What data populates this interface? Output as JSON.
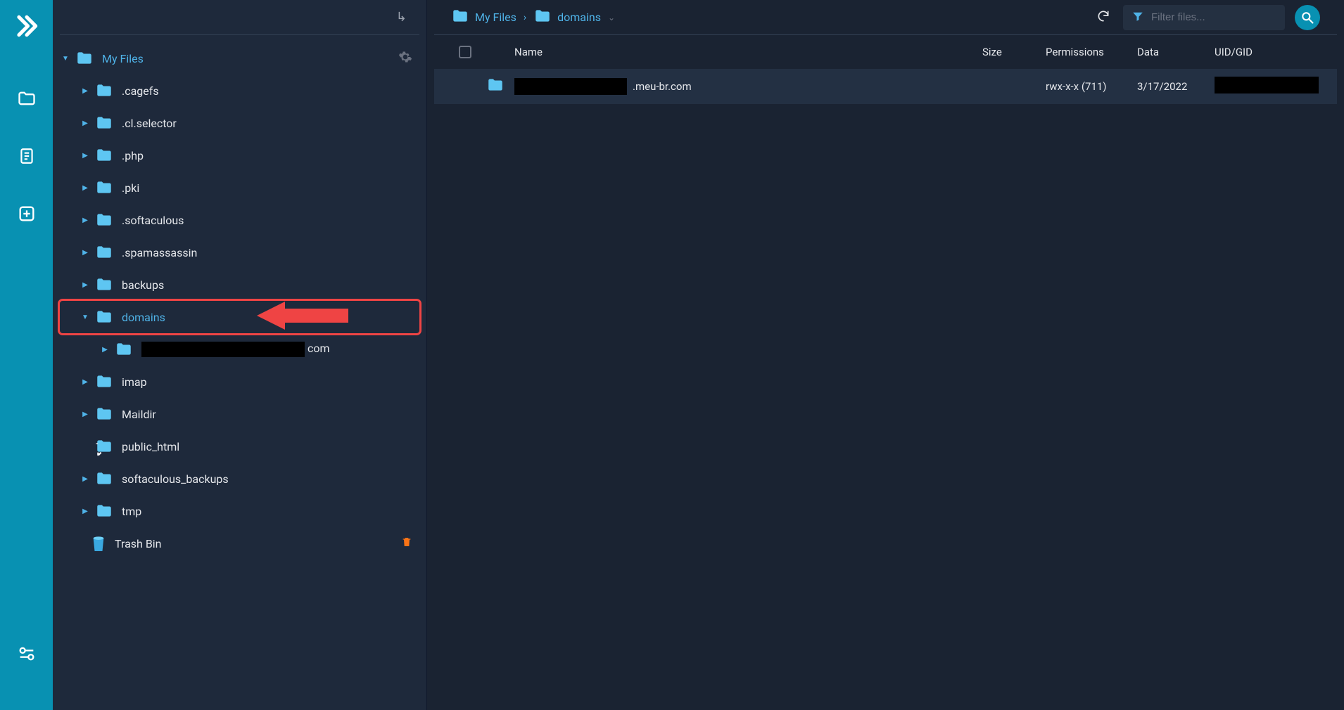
{
  "sidebar": {
    "root_label": "My Files",
    "items": [
      {
        "label": ".cagefs",
        "caret": "right",
        "indent": 1
      },
      {
        "label": ".cl.selector",
        "caret": "right",
        "indent": 1
      },
      {
        "label": ".php",
        "caret": "right",
        "indent": 1
      },
      {
        "label": ".pki",
        "caret": "right",
        "indent": 1
      },
      {
        "label": ".softaculous",
        "caret": "right",
        "indent": 1
      },
      {
        "label": ".spamassassin",
        "caret": "right",
        "indent": 1
      },
      {
        "label": "backups",
        "caret": "right",
        "indent": 1
      },
      {
        "label": "domains",
        "caret": "down",
        "indent": 1,
        "selected": true,
        "annotate": true
      },
      {
        "label": "",
        "suffix": "com",
        "redact_w": 232,
        "caret": "right",
        "indent": 2
      },
      {
        "label": "imap",
        "caret": "right",
        "indent": 1
      },
      {
        "label": "Maildir",
        "caret": "right",
        "indent": 1
      },
      {
        "label": "public_html",
        "caret": "none",
        "indent": 1,
        "icon": "link"
      },
      {
        "label": "softaculous_backups",
        "caret": "right",
        "indent": 1
      },
      {
        "label": "tmp",
        "caret": "right",
        "indent": 1
      }
    ],
    "trash_label": "Trash Bin"
  },
  "breadcrumb": {
    "items": [
      {
        "label": "My Files"
      },
      {
        "label": "domains",
        "dropdown": true
      }
    ]
  },
  "filter": {
    "placeholder": "Filter files..."
  },
  "table": {
    "cols": {
      "name": "Name",
      "size": "Size",
      "perm": "Permissions",
      "date": "Data",
      "uid": "UID/GID"
    },
    "rows": [
      {
        "name_redact_w": 160,
        "name_suffix": ".meu-br.com",
        "size": "",
        "perm": "rwx-x-x (711)",
        "date": "3/17/2022",
        "uid_redact_w": 148
      }
    ]
  }
}
